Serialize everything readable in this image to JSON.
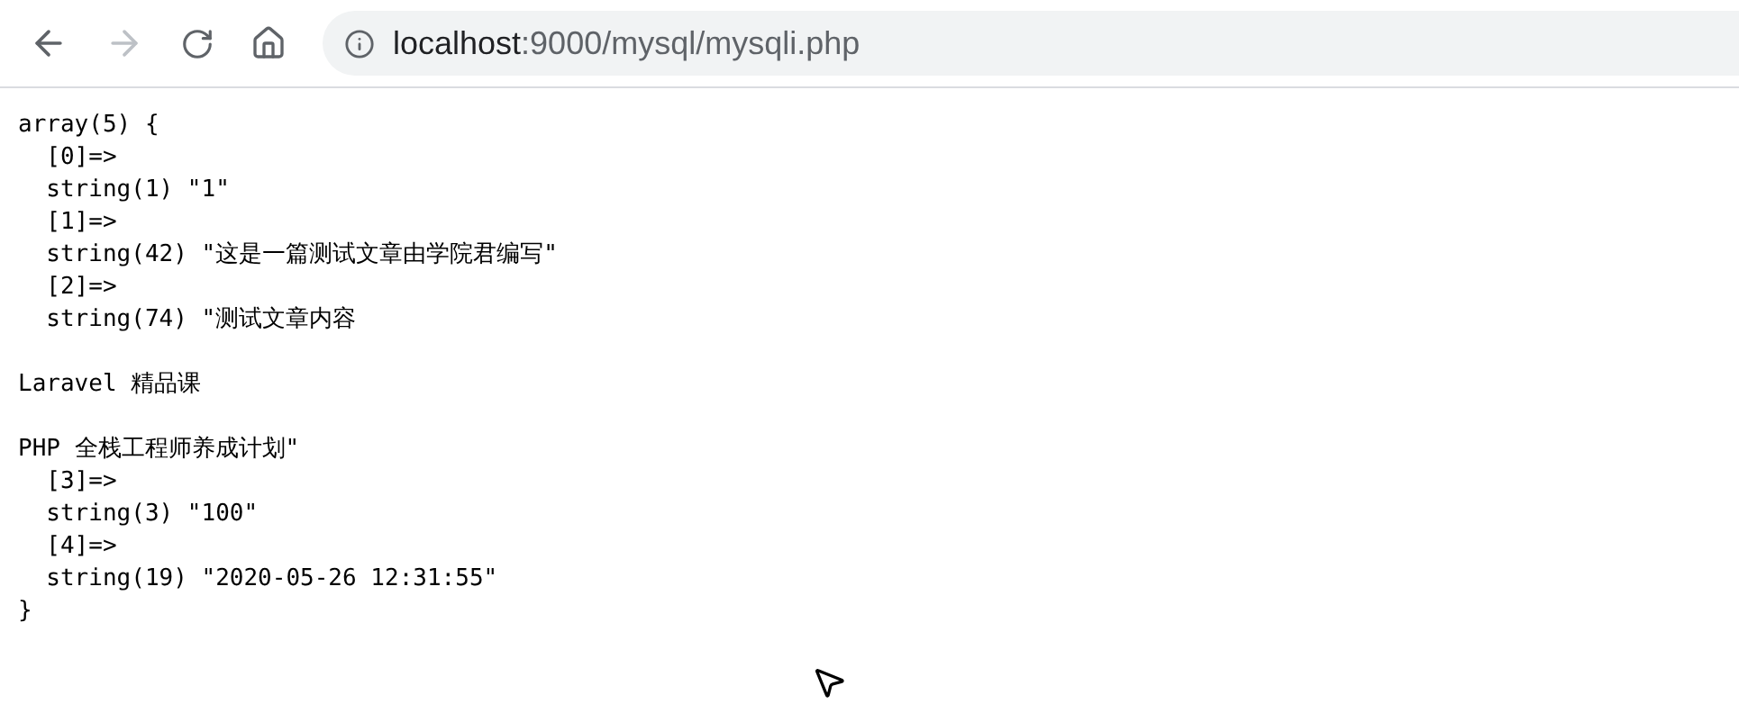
{
  "toolbar": {
    "address": {
      "host": "localhost",
      "path": ":9000/mysql/mysqli.php"
    },
    "forward_disabled": true
  },
  "output_blocks": [
    {
      "lines": [
        "array(5) {",
        "  [0]=>",
        "  string(1) \"1\"",
        "  [1]=>",
        "  string(42) \"这是一篇测试文章由学院君编写\"",
        "  [2]=>",
        "  string(74) \"测试文章内容"
      ]
    },
    {
      "lines": [
        "Laravel 精品课"
      ]
    },
    {
      "lines": [
        "PHP 全栈工程师养成计划\"",
        "  [3]=>",
        "  string(3) \"100\"",
        "  [4]=>",
        "  string(19) \"2020-05-26 12:31:55\"",
        "}"
      ]
    }
  ]
}
